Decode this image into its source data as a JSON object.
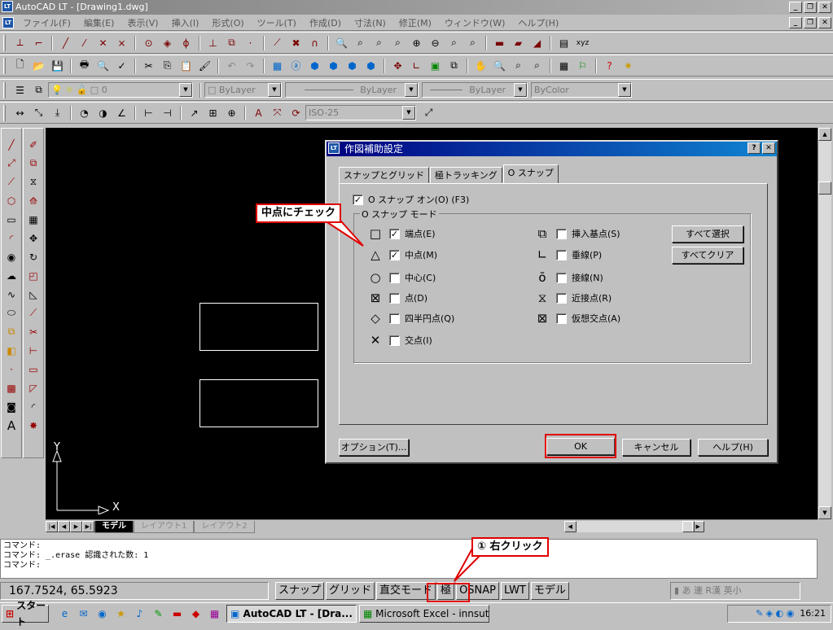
{
  "app": {
    "title": "AutoCAD LT - [Drawing1.dwg]",
    "icon_label": "LT",
    "win_min": "_",
    "win_restore": "❐",
    "win_close": "✕"
  },
  "menu": [
    "ファイル(F)",
    "編集(E)",
    "表示(V)",
    "挿入(I)",
    "形式(O)",
    "ツール(T)",
    "作成(D)",
    "寸法(N)",
    "修正(M)",
    "ウィンドウ(W)",
    "ヘルプ(H)"
  ],
  "layers": {
    "layer_value": "0",
    "color_value": "ByLayer",
    "linetype_value": "ByLayer",
    "lineweight_value": "ByLayer",
    "plotstyle_value": "ByColor",
    "dimstyle_value": "ISO-25"
  },
  "canvas": {
    "ucs_x": "X",
    "ucs_y": "Y",
    "tabs": [
      "モデル",
      "レイアウト1",
      "レイアウト2"
    ]
  },
  "dialog": {
    "title": "作図補助設定",
    "help_btn": "?",
    "close_btn": "✕",
    "tabs": [
      "スナップとグリッド",
      "極トラッキング",
      "O スナップ"
    ],
    "osnap_on_label": "O スナップ オン(O) (F3)",
    "osnap_on_checked": true,
    "mode_group_label": "O スナップ モード",
    "left_modes": [
      {
        "symbol": "□",
        "label": "端点(E)",
        "checked": true
      },
      {
        "symbol": "△",
        "label": "中点(M)",
        "checked": true
      },
      {
        "symbol": "○",
        "label": "中心(C)",
        "checked": false
      },
      {
        "symbol": "⊠",
        "label": "点(D)",
        "checked": false
      },
      {
        "symbol": "◇",
        "label": "四半円点(Q)",
        "checked": false
      },
      {
        "symbol": "✕",
        "label": "交点(I)",
        "checked": false
      }
    ],
    "right_modes": [
      {
        "symbol": "⧉",
        "label": "挿入基点(S)",
        "checked": false
      },
      {
        "symbol": "∟",
        "label": "垂線(P)",
        "checked": false
      },
      {
        "symbol": "ō",
        "label": "接線(N)",
        "checked": false
      },
      {
        "symbol": "⧖",
        "label": "近接点(R)",
        "checked": false
      },
      {
        "symbol": "⊠",
        "label": "仮想交点(A)",
        "checked": false
      }
    ],
    "select_all_btn": "すべて選択",
    "clear_all_btn": "すべてクリア",
    "options_btn": "オプション(T)...",
    "ok_btn": "OK",
    "cancel_btn": "キャンセル",
    "help_button": "ヘルプ(H)"
  },
  "annotations": {
    "midpoint_callout": "中点にチェック",
    "rightclick_callout": "① 右クリック"
  },
  "command": {
    "lines": [
      "コマンド:",
      "コマンド: _.erase 認識された数: 1",
      "コマンド:"
    ]
  },
  "status": {
    "coords": "167.7524,  65.5923",
    "buttons": [
      "スナップ",
      "グリッド",
      "直交モード",
      "極",
      "OSNAP",
      "LWT",
      "モデル"
    ]
  },
  "taskbar": {
    "start": "スタート",
    "tasks": [
      "AutoCAD LT - [Dra...",
      "Microsoft Excel - innsut..."
    ],
    "clock": "16:21"
  },
  "colors": {
    "annotation_red": "#e00000",
    "dialog_title": "#000080",
    "canvas_bg": "#000000"
  }
}
